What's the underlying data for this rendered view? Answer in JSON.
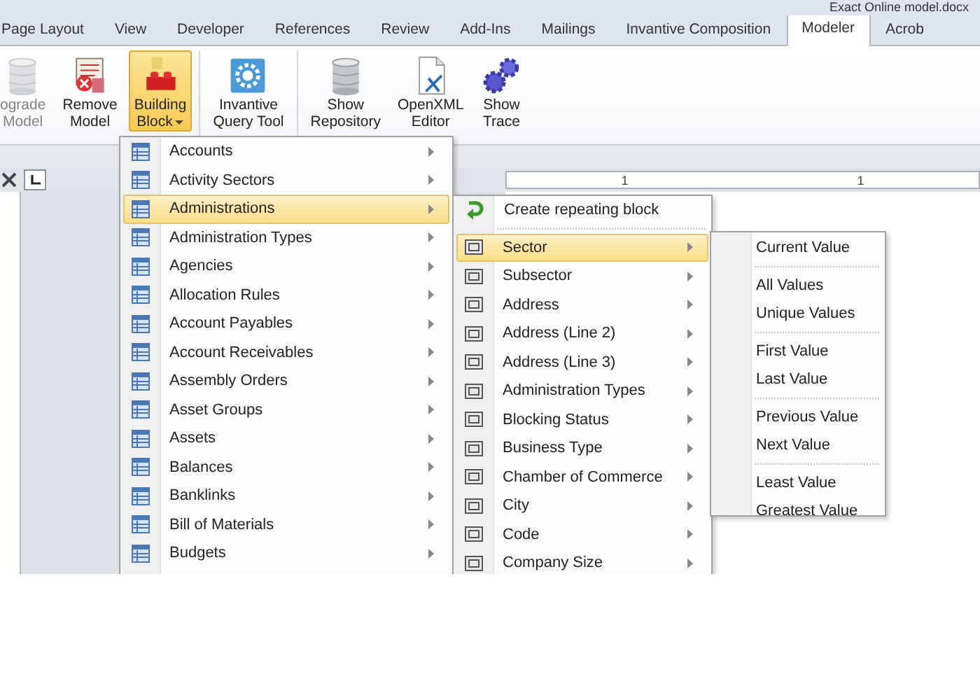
{
  "window": {
    "title": "Exact Online model.docx"
  },
  "tabs": [
    {
      "label": "Page Layout",
      "selected": false
    },
    {
      "label": "View",
      "selected": false
    },
    {
      "label": "Developer",
      "selected": false
    },
    {
      "label": "References",
      "selected": false
    },
    {
      "label": "Review",
      "selected": false
    },
    {
      "label": "Add-Ins",
      "selected": false
    },
    {
      "label": "Mailings",
      "selected": false
    },
    {
      "label": "Invantive Composition",
      "selected": false
    },
    {
      "label": "Modeler",
      "selected": true
    },
    {
      "label": "Acrob",
      "selected": false
    }
  ],
  "ribbon": {
    "buttons": [
      {
        "lines": [
          "ograde",
          "Model"
        ],
        "kind": "database",
        "disabled": true,
        "selected": false,
        "dropdown": false
      },
      {
        "lines": [
          "Remove",
          "Model"
        ],
        "kind": "remove",
        "disabled": false,
        "selected": false,
        "dropdown": false
      },
      {
        "lines": [
          "Building",
          "Block"
        ],
        "kind": "brick",
        "disabled": false,
        "selected": true,
        "dropdown": true
      },
      {
        "lines": [
          "Invantive",
          "Query Tool"
        ],
        "kind": "query",
        "disabled": false,
        "selected": false,
        "dropdown": false
      },
      {
        "lines": [
          "Show",
          "Repository"
        ],
        "kind": "database",
        "disabled": false,
        "selected": false,
        "dropdown": false
      },
      {
        "lines": [
          "OpenXML",
          "Editor"
        ],
        "kind": "document",
        "disabled": false,
        "selected": false,
        "dropdown": false
      },
      {
        "lines": [
          "Show",
          "Trace"
        ],
        "kind": "gears",
        "disabled": false,
        "selected": false,
        "dropdown": false
      }
    ]
  },
  "ruler": {
    "labels": [
      "1",
      "1"
    ]
  },
  "menu": {
    "items": [
      {
        "label": "Accounts",
        "selected": false
      },
      {
        "label": "Activity Sectors",
        "selected": false
      },
      {
        "label": "Administrations",
        "selected": true
      },
      {
        "label": "Administration Types",
        "selected": false
      },
      {
        "label": "Agencies",
        "selected": false
      },
      {
        "label": "Allocation Rules",
        "selected": false
      },
      {
        "label": "Account Payables",
        "selected": false
      },
      {
        "label": "Account Receivables",
        "selected": false
      },
      {
        "label": "Assembly Orders",
        "selected": false
      },
      {
        "label": "Asset Groups",
        "selected": false
      },
      {
        "label": "Assets",
        "selected": false
      },
      {
        "label": "Balances",
        "selected": false
      },
      {
        "label": "Banklinks",
        "selected": false
      },
      {
        "label": "Bill of Materials",
        "selected": false
      },
      {
        "label": "Budgets",
        "selected": false
      }
    ]
  },
  "submenu": {
    "items": [
      {
        "label": "Create repeating block",
        "kind": "action",
        "selected": false
      },
      {
        "label": "Sector",
        "kind": "field",
        "selected": true
      },
      {
        "label": "Subsector",
        "kind": "field",
        "selected": false
      },
      {
        "label": "Address",
        "kind": "field",
        "selected": false
      },
      {
        "label": "Address (Line 2)",
        "kind": "field",
        "selected": false
      },
      {
        "label": "Address (Line 3)",
        "kind": "field",
        "selected": false
      },
      {
        "label": "Administration Types",
        "kind": "field",
        "selected": false
      },
      {
        "label": "Blocking Status",
        "kind": "field",
        "selected": false
      },
      {
        "label": "Business Type",
        "kind": "field",
        "selected": false
      },
      {
        "label": "Chamber of Commerce",
        "kind": "field",
        "selected": false
      },
      {
        "label": "City",
        "kind": "field",
        "selected": false
      },
      {
        "label": "Code",
        "kind": "field",
        "selected": false
      },
      {
        "label": "Company Size",
        "kind": "field",
        "selected": false
      }
    ]
  },
  "value_menu": {
    "groups": [
      [
        "Current Value"
      ],
      [
        "All Values",
        "Unique Values"
      ],
      [
        "First Value",
        "Last Value"
      ],
      [
        "Previous Value",
        "Next Value"
      ],
      [
        "Least Value",
        "Greatest Value"
      ]
    ]
  }
}
